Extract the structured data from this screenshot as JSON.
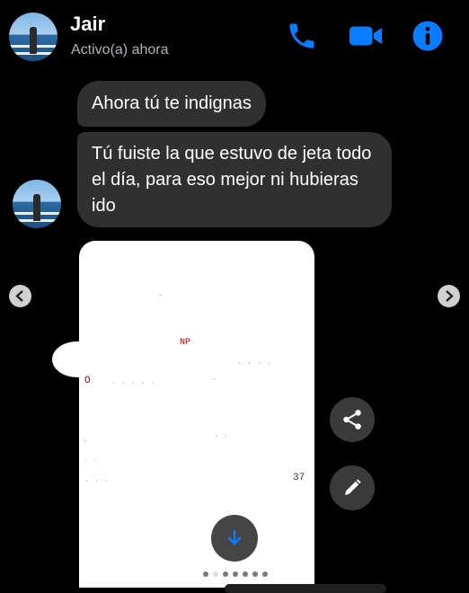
{
  "header": {
    "name": "Jair",
    "status": "Activo(a) ahora",
    "icons": {
      "call": "phone-icon",
      "video": "video-camera-icon",
      "info": "info-icon"
    },
    "accent_color": "#0a7cff"
  },
  "messages": [
    {
      "text": "Ahora tú te indignas"
    },
    {
      "text": "Tú fuiste la que estuvo de jeta todo el día, para eso mejor ni hubieras ido"
    }
  ],
  "photo_fragments": [
    "NP",
    "Ó",
    "37"
  ],
  "viewer": {
    "prev_icon": "chevron-left-icon",
    "next_icon": "chevron-right-icon",
    "share_icon": "share-icon",
    "edit_icon": "pencil-icon",
    "download_icon": "download-arrow-icon",
    "page_count": 7,
    "active_page": 2
  }
}
